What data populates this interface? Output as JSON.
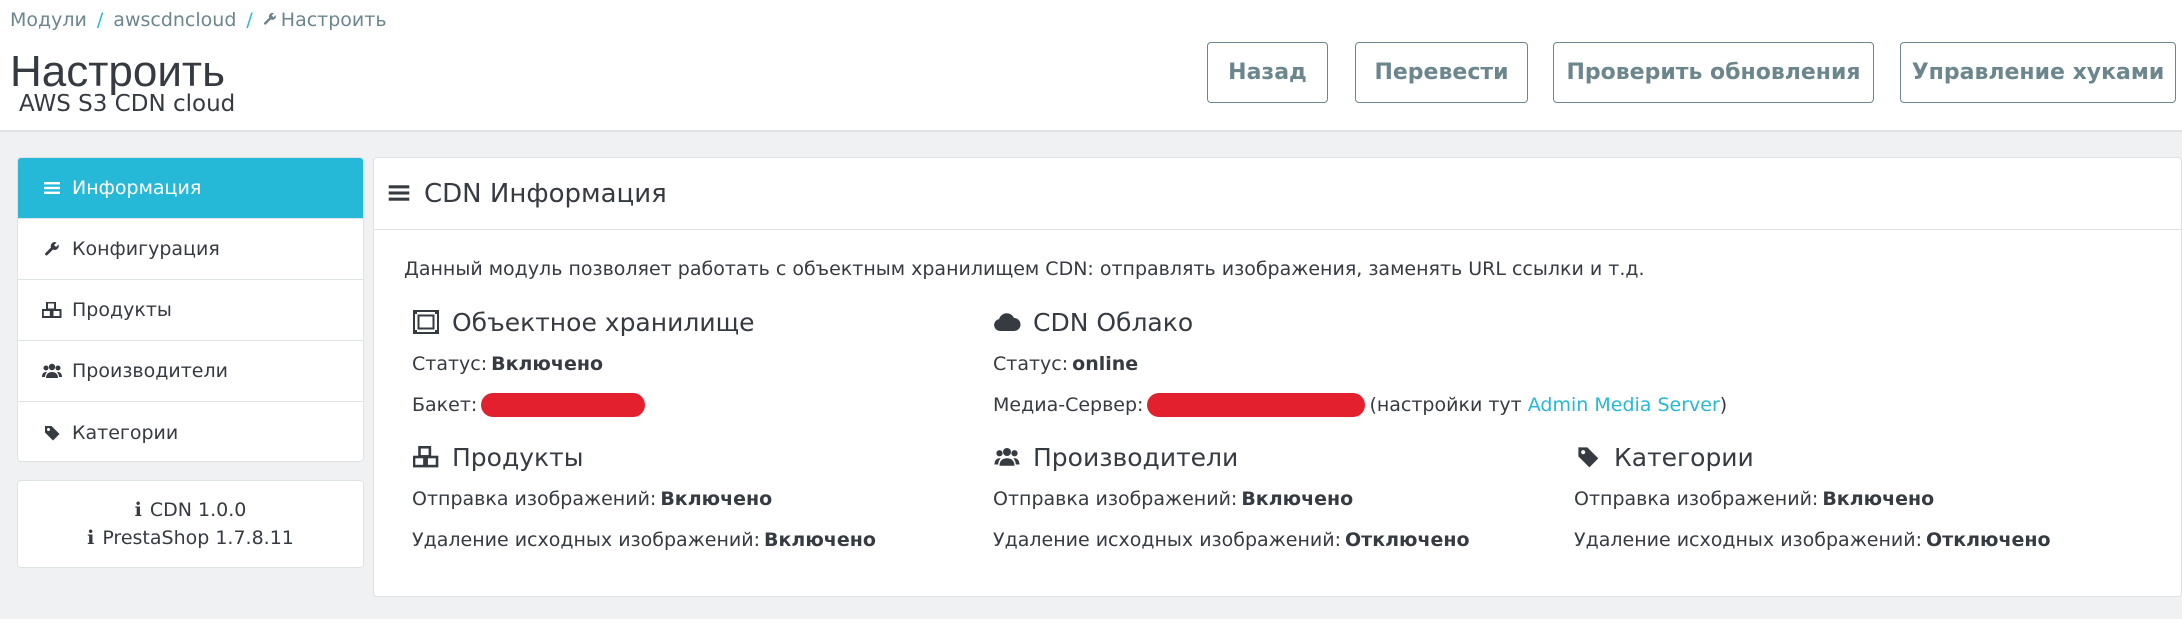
{
  "breadcrumb": {
    "item1": "Модули",
    "sep": "/",
    "item2": "awscdncloud",
    "item3": "Настроить"
  },
  "header": {
    "title": "Настроить",
    "subtitle": "AWS S3 CDN cloud"
  },
  "toolbar": {
    "back": "Назад",
    "translate": "Перевести",
    "check_updates": "Проверить обновления",
    "manage_hooks": "Управление хуками"
  },
  "sidebar": {
    "items": [
      {
        "label": "Информация",
        "icon": "bars-icon",
        "active": true
      },
      {
        "label": "Конфигурация",
        "icon": "wrench-icon",
        "active": false
      },
      {
        "label": "Продукты",
        "icon": "cubes-icon",
        "active": false
      },
      {
        "label": "Производители",
        "icon": "users-icon",
        "active": false
      },
      {
        "label": "Категории",
        "icon": "tag-icon",
        "active": false
      }
    ]
  },
  "versions": {
    "cdn": "CDN 1.0.0",
    "prestashop": "PrestaShop 1.7.8.11"
  },
  "panel": {
    "title": "CDN Информация",
    "description": "Данный модуль позволяет работать с объектным хранилищем CDN: отправлять изображения, заменять URL ссылки и т.д.",
    "storage": {
      "title": "Объектное хранилище",
      "status_label": "Статус:",
      "status_value": "Включено",
      "bucket_label": "Бакет:"
    },
    "cloud": {
      "title": "CDN Облако",
      "status_label": "Статус:",
      "status_value": "online",
      "media_label": "Медиа-Сервер:",
      "settings_prefix": "(настройки тут",
      "settings_link": "Admin Media Server",
      "settings_suffix": ")"
    },
    "products": {
      "title": "Продукты",
      "send_label": "Отправка изображений:",
      "send_value": "Включено",
      "delete_label": "Удаление исходных изображений:",
      "delete_value": "Включено"
    },
    "manufacturers": {
      "title": "Производители",
      "send_label": "Отправка изображений:",
      "send_value": "Включено",
      "delete_label": "Удаление исходных изображений:",
      "delete_value": "Отключено"
    },
    "categories": {
      "title": "Категории",
      "send_label": "Отправка изображений:",
      "send_value": "Включено",
      "delete_label": "Удаление исходных изображений:",
      "delete_value": "Отключено"
    }
  },
  "colors": {
    "accent": "#25b9d7",
    "redaction": "#e3202e",
    "text": "#363a41",
    "muted": "#6c868e"
  }
}
